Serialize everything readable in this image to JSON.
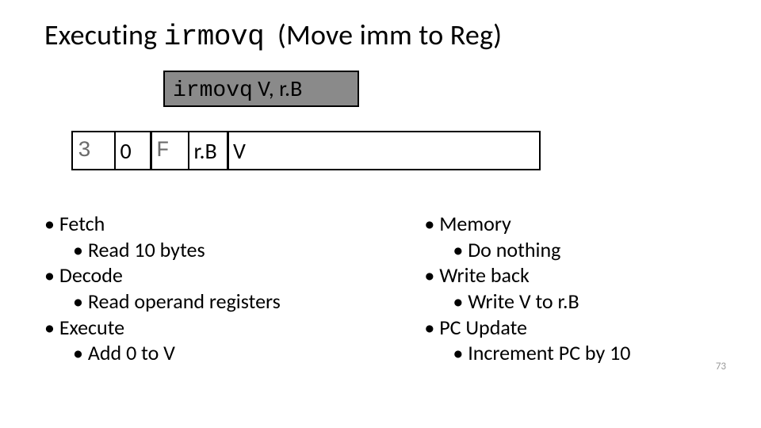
{
  "title": {
    "prefix": "Executing",
    "mono": "irmovq",
    "suffix": "(Move imm to Reg)"
  },
  "syntax": {
    "mono": "irmovq",
    "rest": " V,  r.B"
  },
  "encoding": {
    "b0": "3",
    "b1": "0",
    "b2": "F",
    "b3": "r.B",
    "b4": "V"
  },
  "left": {
    "h0": "Fetch",
    "s0": "Read 10 bytes",
    "h1": "Decode",
    "s1": "Read operand registers",
    "h2": "Execute",
    "s2": "Add 0 to V"
  },
  "right": {
    "h0": "Memory",
    "s0": "Do nothing",
    "h1": "Write back",
    "s1": "Write V to r.B",
    "h2": "PC Update",
    "s2": "Increment PC by 10"
  },
  "page": "73"
}
